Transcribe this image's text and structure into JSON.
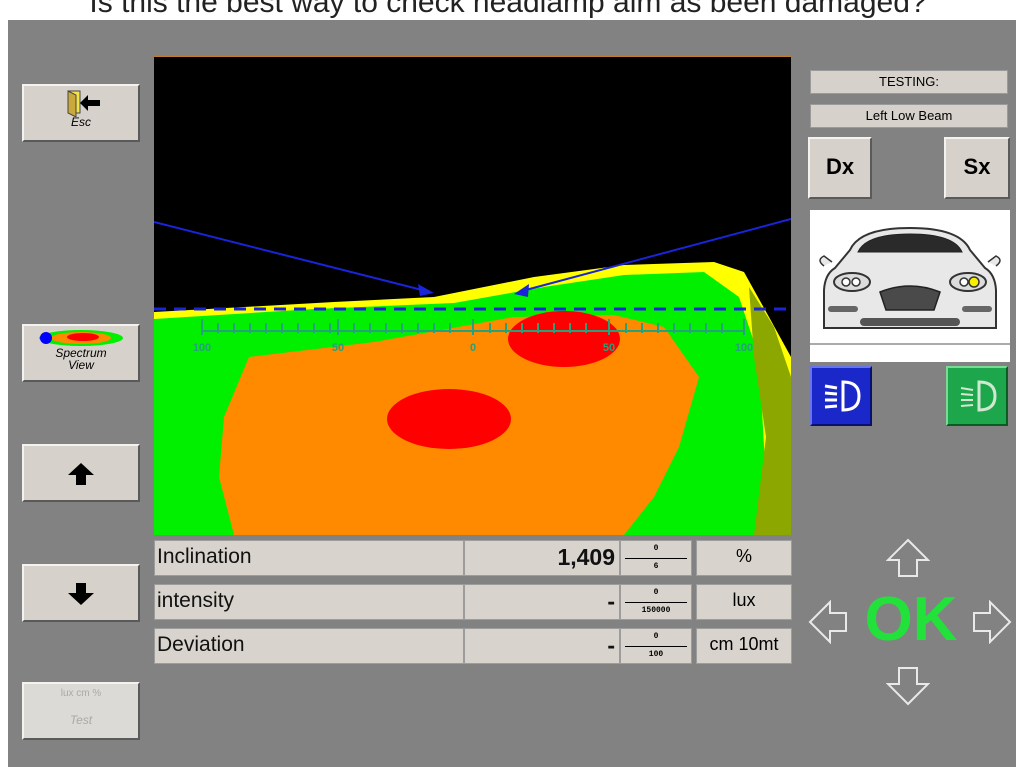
{
  "caption": "Is this the best way to check headlamp aim as been damaged?",
  "toolbar": {
    "esc_label": "Esc",
    "spectrum_label_line1": "Spectrum",
    "spectrum_label_line2": "View",
    "test_label_top": "lux cm %",
    "test_label": "Test"
  },
  "status": {
    "testing_label": "TESTING:",
    "beam_label": "Left Low Beam"
  },
  "side_buttons": {
    "dx_label": "Dx",
    "sx_label": "Sx"
  },
  "ok_label": "OK",
  "scale_labels": [
    "100",
    "50",
    "0",
    "50",
    "100"
  ],
  "readings": [
    {
      "name": "Inclination",
      "value": "1,409",
      "min": "0",
      "max": "6",
      "unit": "%"
    },
    {
      "name": "intensity",
      "value": "-",
      "min": "0",
      "max": "150000",
      "unit": "lux"
    },
    {
      "name": "Deviation",
      "value": "-",
      "min": "0",
      "max": "100",
      "unit": "cm 10mt"
    }
  ],
  "colors": {
    "background": "#828282",
    "ok_green": "#22e13a",
    "beam_orange": "#ff8a00",
    "beam_green": "#00f000",
    "beam_yellow": "#ffff00",
    "beam_red": "#ff0000",
    "cutoff_blue": "#1a24d8",
    "lowbeam_button": "#1a27c9",
    "highbeam_button": "#1ea64d"
  }
}
